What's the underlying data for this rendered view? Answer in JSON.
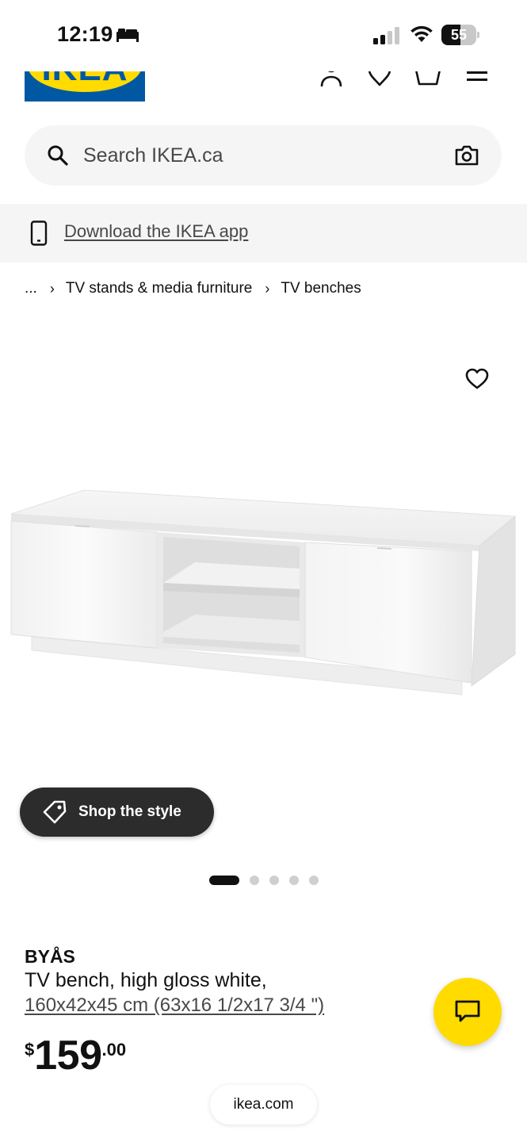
{
  "status_bar": {
    "time": "12:19",
    "battery": "55",
    "battery_level": 0.55
  },
  "header": {
    "logo_text": "IKEA",
    "icons": [
      "account-icon",
      "favorites-icon",
      "cart-icon",
      "menu-icon"
    ]
  },
  "search": {
    "placeholder": "Search IKEA.ca"
  },
  "app_banner": {
    "label": "Download the IKEA app"
  },
  "breadcrumb": {
    "items": [
      "...",
      "TV stands & media furniture",
      "TV benches"
    ]
  },
  "gallery": {
    "shop_style_label": "Shop the style",
    "dot_count": 5,
    "active_index": 0
  },
  "product": {
    "name": "BYÅS",
    "description": "TV bench, high gloss white,",
    "dimensions": "160x42x45 cm (63x16 1/2x17 3/4 \")",
    "price": {
      "currency": "$",
      "main": "159",
      "decimal": ".00"
    }
  },
  "browser": {
    "url": "ikea.com"
  },
  "colors": {
    "ikea_blue": "#0058a3",
    "ikea_yellow": "#ffdb00",
    "dark_pill": "#2c2c2c"
  }
}
